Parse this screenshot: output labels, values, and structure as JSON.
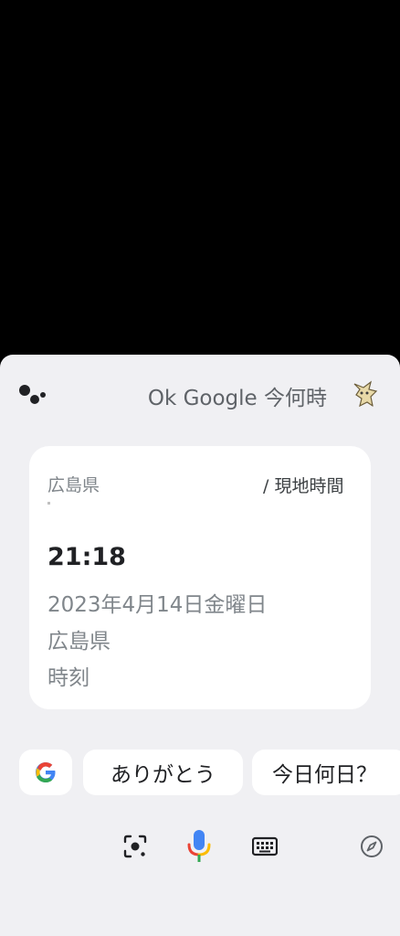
{
  "assistant": {
    "query": "Ok Google 今何時"
  },
  "card": {
    "location_prefix": "広島県",
    "location_suffix": "/ 現地時間",
    "time": "21:18",
    "date": "2023年4月14日金曜日",
    "place": "広島県",
    "label": "時刻"
  },
  "suggestions": {
    "chips": [
      "ありがとう",
      "今日何日？"
    ]
  },
  "colors": {
    "sheet_bg": "#f0f0f3",
    "card_bg": "#ffffff",
    "google_blue": "#4285F4",
    "google_red": "#EA4335",
    "google_yellow": "#FBBC05",
    "google_green": "#34A853"
  },
  "icons": {
    "assistant": "assistant-logo-icon",
    "google": "google-g-icon",
    "lens": "lens-icon",
    "mic": "mic-icon",
    "keyboard": "keyboard-icon",
    "explore": "compass-icon"
  }
}
